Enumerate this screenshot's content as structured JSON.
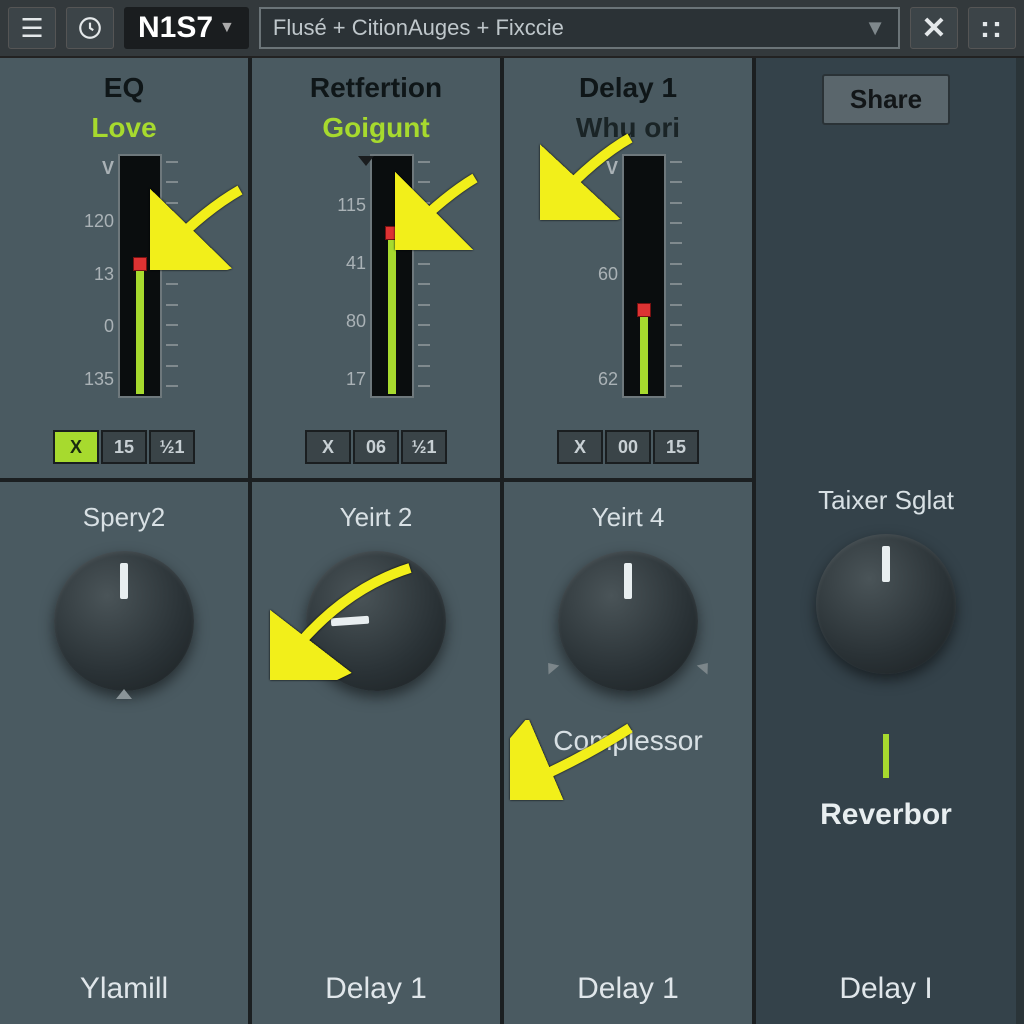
{
  "toolbar": {
    "preset": "N1S7",
    "chain": "Flusé + CitionAuges + Fixccie",
    "close": "✕",
    "share": "Share"
  },
  "channels": [
    {
      "title": "EQ",
      "sub": "Love",
      "vlabel": "V",
      "scale": [
        "",
        "120",
        "13",
        "0",
        "135"
      ],
      "fill_pct": 55,
      "handle_pct": 55,
      "buttons": [
        "X",
        "15",
        "½1"
      ],
      "btn_on": 0,
      "knob_label": "Spery2",
      "lower1": "",
      "bottom": "Ylamill"
    },
    {
      "title": "Retfertion",
      "sub": "Goigunt",
      "vlabel": "",
      "scale": [
        "",
        "115",
        "41",
        "80",
        "17"
      ],
      "fill_pct": 68,
      "handle_pct": 68,
      "buttons": [
        "X",
        "06",
        "½1"
      ],
      "btn_on": -1,
      "knob_label": "Yeirt 2",
      "lower1": "",
      "bottom": "Delay 1"
    },
    {
      "title": "Delay 1",
      "sub": "Whu ori",
      "vlabel": "V",
      "scale": [
        "",
        "",
        "60",
        "",
        "62"
      ],
      "fill_pct": 36,
      "handle_pct": 36,
      "buttons": [
        "X",
        "00",
        "15"
      ],
      "btn_on": -1,
      "knob_label": "Yeirt 4",
      "lower1": "Complessor",
      "bottom": "Delay 1"
    }
  ],
  "right": {
    "knob_label": "Taixer Sglat",
    "reverb": "Reverbor",
    "bottom": "Delay I"
  }
}
